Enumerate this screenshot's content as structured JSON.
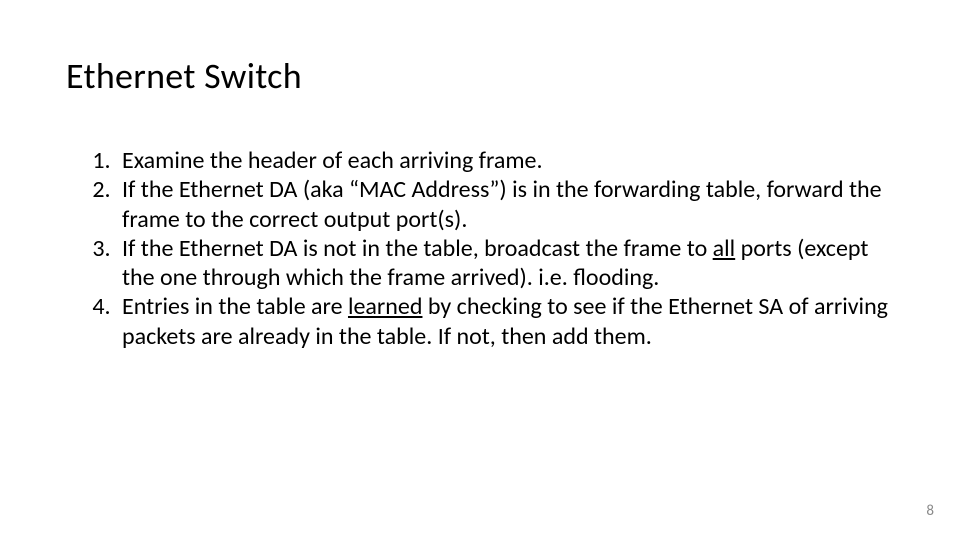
{
  "title": "Ethernet Switch",
  "items": {
    "i1": "Examine the header of each arriving frame.",
    "i2": "If the Ethernet DA (aka “MAC Address”) is in the forwarding table, forward the frame to the correct output port(s).",
    "i3a": "If the Ethernet DA is not in the table, broadcast the frame to ",
    "i3u": "all",
    "i3b": " ports (except the one through which the frame arrived). i.e. flooding.",
    "i4a": "Entries in the table are ",
    "i4u": "learned",
    "i4b": " by checking to see if the Ethernet SA of arriving packets are already in the table. If not, then add them."
  },
  "page_number": "8"
}
